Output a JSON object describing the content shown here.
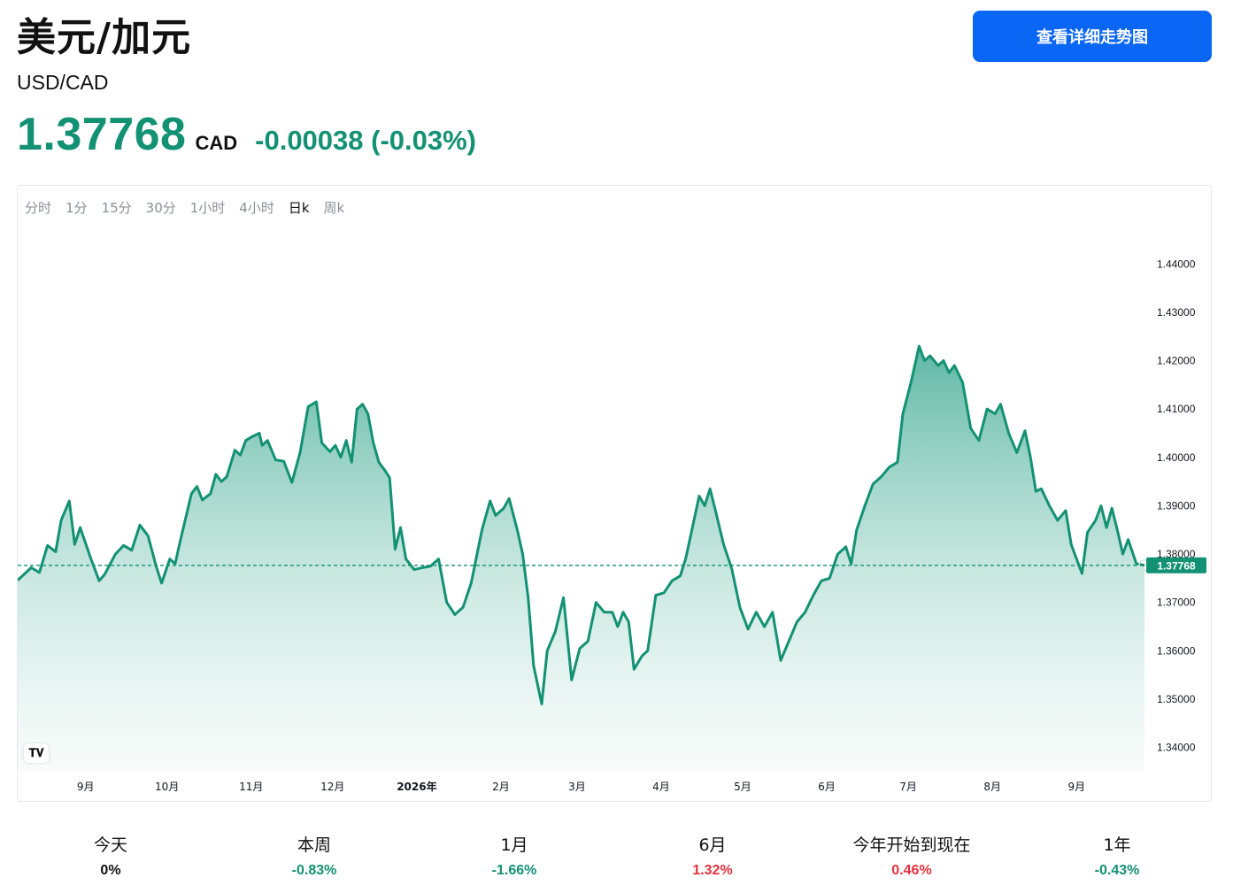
{
  "header": {
    "title": "美元/加元",
    "subtitle": "USD/CAD",
    "price": "1.37768",
    "currency": "CAD",
    "change": "-0.00038 (-0.03%)",
    "detail_button": "查看详细走势图"
  },
  "tabs": [
    "分时",
    "1分",
    "15分",
    "30分",
    "1小时",
    "4小时",
    "日k",
    "周k"
  ],
  "active_tab": "日k",
  "colors": {
    "line": "#139173",
    "fill_top": "#56b4a0",
    "negative": "#139173",
    "positive": "#e5323e",
    "button": "#0a66f5"
  },
  "chart_data": {
    "type": "area",
    "title": "",
    "xlabel": "",
    "ylabel": "",
    "ylim": [
      1.335,
      1.447
    ],
    "y_ticks": [
      "1.44000",
      "1.43000",
      "1.42000",
      "1.41000",
      "1.40000",
      "1.39000",
      "1.38000",
      "1.37000",
      "1.36000",
      "1.35000",
      "1.34000"
    ],
    "x_ticks": [
      {
        "label": "9月",
        "date": "2025-09-01"
      },
      {
        "label": "10月",
        "date": "2025-10-01"
      },
      {
        "label": "11月",
        "date": "2025-11-01"
      },
      {
        "label": "12月",
        "date": "2025-12-01"
      },
      {
        "label": "2026年",
        "date": "2026-01-01",
        "bold": true
      },
      {
        "label": "2月",
        "date": "2026-02-01"
      },
      {
        "label": "3月",
        "date": "2026-03-01"
      },
      {
        "label": "4月",
        "date": "2026-04-01"
      },
      {
        "label": "5月",
        "date": "2026-05-01"
      },
      {
        "label": "6月",
        "date": "2026-06-01"
      },
      {
        "label": "7月",
        "date": "2026-07-01"
      },
      {
        "label": "8月",
        "date": "2026-08-01"
      },
      {
        "label": "9月",
        "date": "2026-09-01"
      }
    ],
    "last_price": 1.37768,
    "last_price_label": "1.37768",
    "series": [
      {
        "points": [
          [
            "2025-08-07",
            1.3746
          ],
          [
            "2025-08-12",
            1.3772
          ],
          [
            "2025-08-15",
            1.3762
          ],
          [
            "2025-08-18",
            1.3818
          ],
          [
            "2025-08-21",
            1.3805
          ],
          [
            "2025-08-23",
            1.387
          ],
          [
            "2025-08-26",
            1.391
          ],
          [
            "2025-08-28",
            1.382
          ],
          [
            "2025-08-30",
            1.3855
          ],
          [
            "2025-09-03",
            1.379
          ],
          [
            "2025-09-06",
            1.3745
          ],
          [
            "2025-09-08",
            1.3758
          ],
          [
            "2025-09-12",
            1.38
          ],
          [
            "2025-09-15",
            1.3818
          ],
          [
            "2025-09-18",
            1.3808
          ],
          [
            "2025-09-21",
            1.386
          ],
          [
            "2025-09-24",
            1.3838
          ],
          [
            "2025-09-27",
            1.3775
          ],
          [
            "2025-09-29",
            1.374
          ],
          [
            "2025-10-02",
            1.379
          ],
          [
            "2025-10-04",
            1.378
          ],
          [
            "2025-10-06",
            1.383
          ],
          [
            "2025-10-10",
            1.3925
          ],
          [
            "2025-10-12",
            1.394
          ],
          [
            "2025-10-14",
            1.3912
          ],
          [
            "2025-10-17",
            1.3925
          ],
          [
            "2025-10-19",
            1.3965
          ],
          [
            "2025-10-21",
            1.395
          ],
          [
            "2025-10-23",
            1.396
          ],
          [
            "2025-10-26",
            1.4015
          ],
          [
            "2025-10-28",
            1.4005
          ],
          [
            "2025-10-30",
            1.4035
          ],
          [
            "2025-11-01",
            1.4042
          ],
          [
            "2025-11-04",
            1.405
          ],
          [
            "2025-11-05",
            1.4025
          ],
          [
            "2025-11-07",
            1.4035
          ],
          [
            "2025-11-10",
            1.3995
          ],
          [
            "2025-11-13",
            1.3992
          ],
          [
            "2025-11-16",
            1.3948
          ],
          [
            "2025-11-19",
            1.401
          ],
          [
            "2025-11-22",
            1.4105
          ],
          [
            "2025-11-25",
            1.4115
          ],
          [
            "2025-11-27",
            1.403
          ],
          [
            "2025-11-30",
            1.4012
          ],
          [
            "2025-12-02",
            1.4025
          ],
          [
            "2025-12-04",
            1.4
          ],
          [
            "2025-12-06",
            1.4035
          ],
          [
            "2025-12-08",
            1.399
          ],
          [
            "2025-12-10",
            1.41
          ],
          [
            "2025-12-12",
            1.411
          ],
          [
            "2025-12-14",
            1.409
          ],
          [
            "2025-12-16",
            1.403
          ],
          [
            "2025-12-18",
            1.399
          ],
          [
            "2025-12-20",
            1.3975
          ],
          [
            "2025-12-22",
            1.3958
          ],
          [
            "2025-12-24",
            1.381
          ],
          [
            "2025-12-26",
            1.3855
          ],
          [
            "2025-12-28",
            1.379
          ],
          [
            "2025-12-31",
            1.3768
          ],
          [
            "2026-01-03",
            1.3772
          ],
          [
            "2026-01-06",
            1.3775
          ],
          [
            "2026-01-09",
            1.379
          ],
          [
            "2026-01-12",
            1.37
          ],
          [
            "2026-01-15",
            1.3675
          ],
          [
            "2026-01-18",
            1.369
          ],
          [
            "2026-01-21",
            1.374
          ],
          [
            "2026-01-25",
            1.385
          ],
          [
            "2026-01-28",
            1.391
          ],
          [
            "2026-01-30",
            1.388
          ],
          [
            "2026-02-02",
            1.3895
          ],
          [
            "2026-02-04",
            1.3915
          ],
          [
            "2026-02-07",
            1.385
          ],
          [
            "2026-02-09",
            1.38
          ],
          [
            "2026-02-11",
            1.371
          ],
          [
            "2026-02-13",
            1.357
          ],
          [
            "2026-02-16",
            1.349
          ],
          [
            "2026-02-18",
            1.36
          ],
          [
            "2026-02-21",
            1.364
          ],
          [
            "2026-02-24",
            1.371
          ],
          [
            "2026-02-27",
            1.354
          ],
          [
            "2026-03-02",
            1.3605
          ],
          [
            "2026-03-05",
            1.362
          ],
          [
            "2026-03-08",
            1.37
          ],
          [
            "2026-03-11",
            1.368
          ],
          [
            "2026-03-14",
            1.368
          ],
          [
            "2026-03-16",
            1.365
          ],
          [
            "2026-03-18",
            1.368
          ],
          [
            "2026-03-20",
            1.366
          ],
          [
            "2026-03-22",
            1.3562
          ],
          [
            "2026-03-25",
            1.359
          ],
          [
            "2026-03-27",
            1.36
          ],
          [
            "2026-03-30",
            1.3715
          ],
          [
            "2026-04-02",
            1.372
          ],
          [
            "2026-04-05",
            1.3745
          ],
          [
            "2026-04-08",
            1.3755
          ],
          [
            "2026-04-10",
            1.379
          ],
          [
            "2026-04-13",
            1.3868
          ],
          [
            "2026-04-15",
            1.392
          ],
          [
            "2026-04-17",
            1.39
          ],
          [
            "2026-04-19",
            1.3935
          ],
          [
            "2026-04-21",
            1.389
          ],
          [
            "2026-04-24",
            1.382
          ],
          [
            "2026-04-27",
            1.377
          ],
          [
            "2026-04-30",
            1.369
          ],
          [
            "2026-05-03",
            1.3645
          ],
          [
            "2026-05-06",
            1.368
          ],
          [
            "2026-05-09",
            1.365
          ],
          [
            "2026-05-12",
            1.368
          ],
          [
            "2026-05-15",
            1.358
          ],
          [
            "2026-05-18",
            1.362
          ],
          [
            "2026-05-21",
            1.366
          ],
          [
            "2026-05-24",
            1.368
          ],
          [
            "2026-05-27",
            1.3715
          ],
          [
            "2026-05-30",
            1.3745
          ],
          [
            "2026-06-02",
            1.375
          ],
          [
            "2026-06-05",
            1.38
          ],
          [
            "2026-06-08",
            1.3815
          ],
          [
            "2026-06-10",
            1.378
          ],
          [
            "2026-06-12",
            1.385
          ],
          [
            "2026-06-15",
            1.39
          ],
          [
            "2026-06-18",
            1.3945
          ],
          [
            "2026-06-21",
            1.396
          ],
          [
            "2026-06-24",
            1.398
          ],
          [
            "2026-06-27",
            1.399
          ],
          [
            "2026-06-29",
            1.409
          ],
          [
            "2026-07-02",
            1.4155
          ],
          [
            "2026-07-05",
            1.423
          ],
          [
            "2026-07-07",
            1.42
          ],
          [
            "2026-07-09",
            1.421
          ],
          [
            "2026-07-12",
            1.419
          ],
          [
            "2026-07-14",
            1.42
          ],
          [
            "2026-07-16",
            1.4175
          ],
          [
            "2026-07-18",
            1.419
          ],
          [
            "2026-07-21",
            1.4155
          ],
          [
            "2026-07-24",
            1.406
          ],
          [
            "2026-07-27",
            1.4035
          ],
          [
            "2026-07-30",
            1.41
          ],
          [
            "2026-08-02",
            1.409
          ],
          [
            "2026-08-04",
            1.411
          ],
          [
            "2026-08-07",
            1.405
          ],
          [
            "2026-08-10",
            1.401
          ],
          [
            "2026-08-13",
            1.4055
          ],
          [
            "2026-08-15",
            1.4
          ],
          [
            "2026-08-17",
            1.393
          ],
          [
            "2026-08-19",
            1.3935
          ],
          [
            "2026-08-22",
            1.39
          ],
          [
            "2026-08-25",
            1.387
          ],
          [
            "2026-08-28",
            1.389
          ],
          [
            "2026-08-30",
            1.382
          ],
          [
            "2026-09-01",
            1.379
          ],
          [
            "2026-09-03",
            1.376
          ],
          [
            "2026-09-05",
            1.3845
          ],
          [
            "2026-09-08",
            1.387
          ],
          [
            "2026-09-10",
            1.39
          ],
          [
            "2026-09-12",
            1.3855
          ],
          [
            "2026-09-14",
            1.3895
          ],
          [
            "2026-09-16",
            1.385
          ],
          [
            "2026-09-18",
            1.38
          ],
          [
            "2026-09-20",
            1.383
          ],
          [
            "2026-09-23",
            1.378
          ],
          [
            "2026-09-26",
            1.3777
          ]
        ]
      }
    ],
    "grid": false
  },
  "stats": [
    {
      "label": "今天",
      "value": "0%",
      "tone": "neutral"
    },
    {
      "label": "本周",
      "value": "-0.83%",
      "tone": "negative"
    },
    {
      "label": "1月",
      "value": "-1.66%",
      "tone": "negative"
    },
    {
      "label": "6月",
      "value": "1.32%",
      "tone": "positive"
    },
    {
      "label": "今年开始到现在",
      "value": "0.46%",
      "tone": "positive"
    },
    {
      "label": "1年",
      "value": "-0.43%",
      "tone": "negative"
    }
  ]
}
